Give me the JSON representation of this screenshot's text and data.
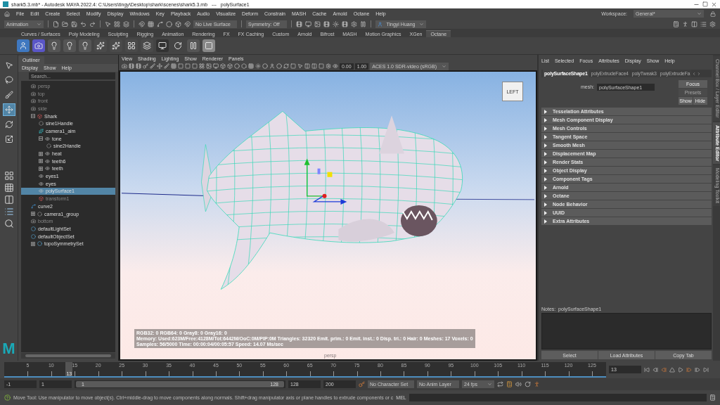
{
  "window": {
    "title": "shark5.3.mb* - Autodesk MAYA 2022.4: C:\\Users\\tingy\\Desktop\\shark\\scenes\\shark5.3.mb   ---   polySurface1"
  },
  "menu_bar": [
    "File",
    "Edit",
    "Create",
    "Select",
    "Modify",
    "Display",
    "Windows",
    "Key",
    "Playback",
    "Audio",
    "Visualize",
    "Deform",
    "Constrain",
    "MASH",
    "Cache",
    "Arnold",
    "Octane",
    "Help"
  ],
  "status_line": {
    "mode": "Animation",
    "live_surface": "No Live Surface",
    "symmetry": "Symmetry: Off",
    "user": "Tingyi Huang",
    "workspace_label": "Workspace:",
    "workspace": "General*"
  },
  "shelf": {
    "tabs": [
      {
        "label": "Curves / Surfaces",
        "selected": false
      },
      {
        "label": "Poly Modeling",
        "selected": false
      },
      {
        "label": "Sculpting",
        "selected": false
      },
      {
        "label": "Rigging",
        "selected": false
      },
      {
        "label": "Animation",
        "selected": false
      },
      {
        "label": "Rendering",
        "selected": false
      },
      {
        "label": "FX",
        "selected": false
      },
      {
        "label": "FX Caching",
        "selected": false
      },
      {
        "label": "Custom",
        "selected": false
      },
      {
        "label": "Arnold",
        "selected": false
      },
      {
        "label": "Bifrost",
        "selected": false
      },
      {
        "label": "MASH",
        "selected": false
      },
      {
        "label": "Motion Graphics",
        "selected": false
      },
      {
        "label": "XGen",
        "selected": false
      },
      {
        "label": "Octane",
        "selected": true
      }
    ]
  },
  "toolbox": [
    {
      "kind": "select",
      "selected": false
    },
    {
      "kind": "lasso",
      "selected": false
    },
    {
      "kind": "paint",
      "selected": false
    },
    {
      "kind": "move",
      "selected": true
    },
    {
      "kind": "rotate",
      "selected": false
    },
    {
      "kind": "scale",
      "selected": false
    }
  ],
  "app_logo": "M",
  "outliner": {
    "title": "Outliner",
    "menu": [
      "Display",
      "Show",
      "Help"
    ],
    "search": {
      "placeholder": "Search..."
    },
    "items": [
      {
        "label": "persp",
        "kind": "camera",
        "hidden": true,
        "selected": false
      },
      {
        "label": "top",
        "kind": "camera",
        "hidden": true,
        "selected": false
      },
      {
        "label": "front",
        "kind": "camera",
        "hidden": true,
        "selected": false
      },
      {
        "label": "side",
        "kind": "camera",
        "hidden": true,
        "selected": false
      },
      {
        "label": "Shark",
        "kind": "group",
        "hidden": false,
        "selected": false,
        "expanded": true,
        "children": [
          {
            "label": "sine1Handle",
            "kind": "handle",
            "hidden": false,
            "selected": false
          },
          {
            "label": "camera1_aim",
            "kind": "locator",
            "hidden": false,
            "selected": false
          },
          {
            "label": "tone",
            "kind": "mesh",
            "hidden": false,
            "selected": false,
            "expanded": true,
            "children": [
              {
                "label": "sine2Handle",
                "kind": "handle",
                "hidden": false,
                "selected": false
              }
            ]
          },
          {
            "label": "heat",
            "kind": "mesh",
            "hidden": false,
            "selected": false,
            "expanded": false
          },
          {
            "label": "teeth6",
            "kind": "mesh",
            "hidden": false,
            "selected": false,
            "expanded": false
          },
          {
            "label": "teeth",
            "kind": "mesh",
            "hidden": false,
            "selected": false,
            "expanded": false
          },
          {
            "label": "eyes1",
            "kind": "mesh",
            "hidden": false,
            "selected": false
          },
          {
            "label": "eyes",
            "kind": "mesh",
            "hidden": false,
            "selected": false
          },
          {
            "label": "polySurface1",
            "kind": "mesh",
            "hidden": false,
            "selected": true
          },
          {
            "label": "transform1",
            "kind": "group",
            "hidden": true,
            "selected": false
          }
        ]
      },
      {
        "label": "curve2",
        "kind": "curve",
        "hidden": false,
        "selected": false
      },
      {
        "label": "camera1_group",
        "kind": "handle",
        "hidden": false,
        "selected": false,
        "expanded": false
      },
      {
        "label": "bottom",
        "kind": "camera",
        "hidden": true,
        "selected": false
      },
      {
        "label": "defaultLightSet",
        "kind": "set",
        "hidden": false,
        "selected": false
      },
      {
        "label": "defaultObjectSet",
        "kind": "set",
        "hidden": false,
        "selected": false
      },
      {
        "label": "topoSymmetrySet",
        "kind": "set",
        "hidden": false,
        "selected": false,
        "expanded": false
      }
    ]
  },
  "viewport": {
    "menu": [
      "View",
      "Shading",
      "Lighting",
      "Show",
      "Renderer",
      "Panels"
    ],
    "exposure": "0.00",
    "gamma": "1.00",
    "color_space": "ACES 1.0 SDR-video (sRGB)",
    "view_cube": "LEFT",
    "camera": "persp",
    "hud": [
      "RGB32: 0 RGB64: 0 Gray8: 0 Gray16: 0",
      "Memory: Used:623M/Free:4128M/Tot:6442M/OoC:0M/PIP:0M Triangles: 32320 Emit. prim.: 0 Emit. inst.: 0 Disp. tri.: 0 Hair: 0 Meshes: 17 Voxels: 0",
      "Samples: 56/5000 Time: 00:00:04/00:05:57 Speed: 14.07 Ms/sec"
    ]
  },
  "attribute_editor": {
    "menu": [
      "List",
      "Selected",
      "Focus",
      "Attributes",
      "Display",
      "Show",
      "Help"
    ],
    "tabs": [
      {
        "label": "polySurfaceShape1",
        "selected": true
      },
      {
        "label": "polyExtrudeFace4",
        "selected": false
      },
      {
        "label": "polyTweak3",
        "selected": false
      },
      {
        "label": "polyExtrudeFa",
        "selected": false
      }
    ],
    "mesh_label": "mesh:",
    "mesh_value": "polySurfaceShape1",
    "buttons": [
      {
        "label": "Focus",
        "disabled": false
      },
      {
        "label": "Presets",
        "disabled": true
      },
      {
        "label": "Show",
        "disabled": false
      },
      {
        "label": "Hide",
        "disabled": false
      }
    ],
    "sections": [
      "Tesselation Attributes",
      "Mesh Component Display",
      "Mesh Controls",
      "Tangent Space",
      "Smooth Mesh",
      "Displacement Map",
      "Render Stats",
      "Object Display",
      "Component Tags",
      "Arnold",
      "Octane",
      "Node Behavior",
      "UUID",
      "Extra Attributes"
    ],
    "notes": "Notes:  polySurfaceShape1",
    "footer_buttons": [
      "Select",
      "Load Attributes",
      "Copy Tab"
    ]
  },
  "side_tabs": [
    {
      "label": "Channel Box / Layer Editor",
      "selected": false
    },
    {
      "label": "Attribute Editor",
      "selected": true
    },
    {
      "label": "Modeling Toolkit",
      "selected": false
    }
  ],
  "timeline": {
    "ticks": [
      "5",
      "10",
      "15",
      "20",
      "25",
      "30",
      "35",
      "40",
      "45",
      "50",
      "55",
      "60",
      "65",
      "70",
      "75",
      "80",
      "85",
      "90",
      "95",
      "100",
      "105",
      "110",
      "115",
      "120",
      "125"
    ],
    "current": "13",
    "level": 0.102,
    "current_field": "13"
  },
  "range": {
    "level": 1,
    "anim_start": "-1",
    "play_start": "1",
    "slider_start": "1",
    "slider_end": "128",
    "play_end": "128",
    "anim_end": "200",
    "character_set": "No Character Set",
    "anim_layer": "No Anim Layer",
    "fps": "24 fps"
  },
  "help_line": {
    "text": "Move Tool: Use manipulator to move object(s). Ctrl+middle-drag to move components along normals. Shift+drag manipulator axis or plane handles to extrude components or c",
    "command_label": "MEL"
  }
}
